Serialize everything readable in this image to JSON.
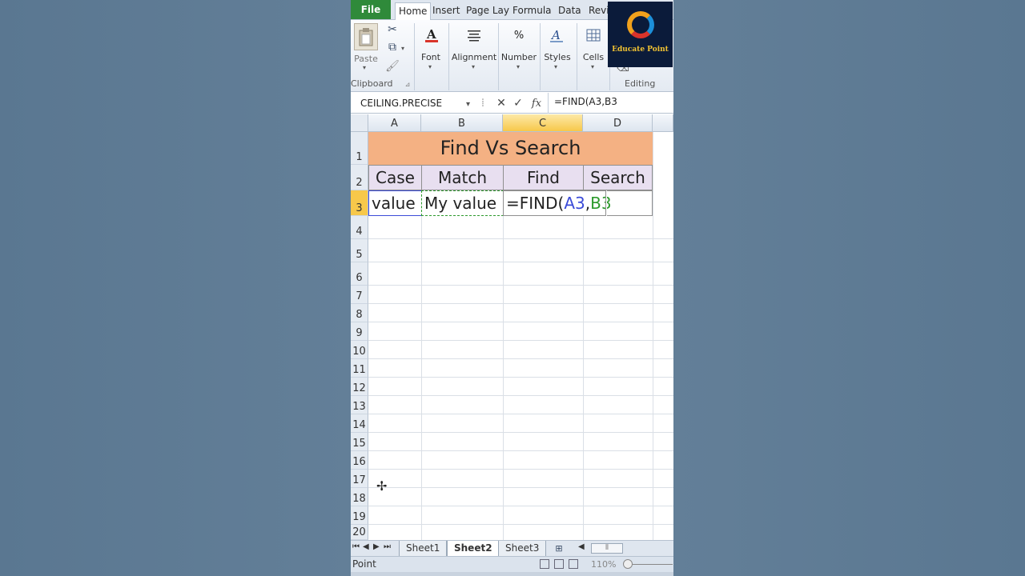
{
  "ribbon": {
    "tabs": [
      "File",
      "Home",
      "Insert",
      "Page Lay",
      "Formula:",
      "Data",
      "Revi"
    ],
    "groups": {
      "clipboard": {
        "paste": "Paste",
        "label": "Clipboard"
      },
      "font": "Font",
      "alignment": "Alignment",
      "number": "Number",
      "number_symbol": "%",
      "styles": "Styles",
      "cells": "Cells",
      "editing": "Editing"
    },
    "logo_text": "Educate Point"
  },
  "formula_bar": {
    "name_box": "CEILING.PRECISE",
    "fx": "fx",
    "formula": "=FIND(A3,B3"
  },
  "columns": [
    "A",
    "B",
    "C",
    "D"
  ],
  "rows": [
    "1",
    "2",
    "3",
    "4",
    "5",
    "6",
    "7",
    "8",
    "9",
    "10",
    "11",
    "12",
    "13",
    "14",
    "15",
    "16",
    "17",
    "18",
    "19",
    "20"
  ],
  "sheet": {
    "title": "Find Vs Search",
    "headers": [
      "Case",
      "Match",
      "Find",
      "Search"
    ],
    "row3": {
      "a": "value",
      "b": "My value",
      "c_prefix": "=FIND(",
      "c_ref_a": "A3",
      "c_comma": ",",
      "c_ref_b": "B3"
    }
  },
  "sheet_tabs": [
    "Sheet1",
    "Sheet2",
    "Sheet3"
  ],
  "active_sheet": "Sheet2",
  "status": {
    "mode": "Point",
    "zoom": "110%"
  }
}
